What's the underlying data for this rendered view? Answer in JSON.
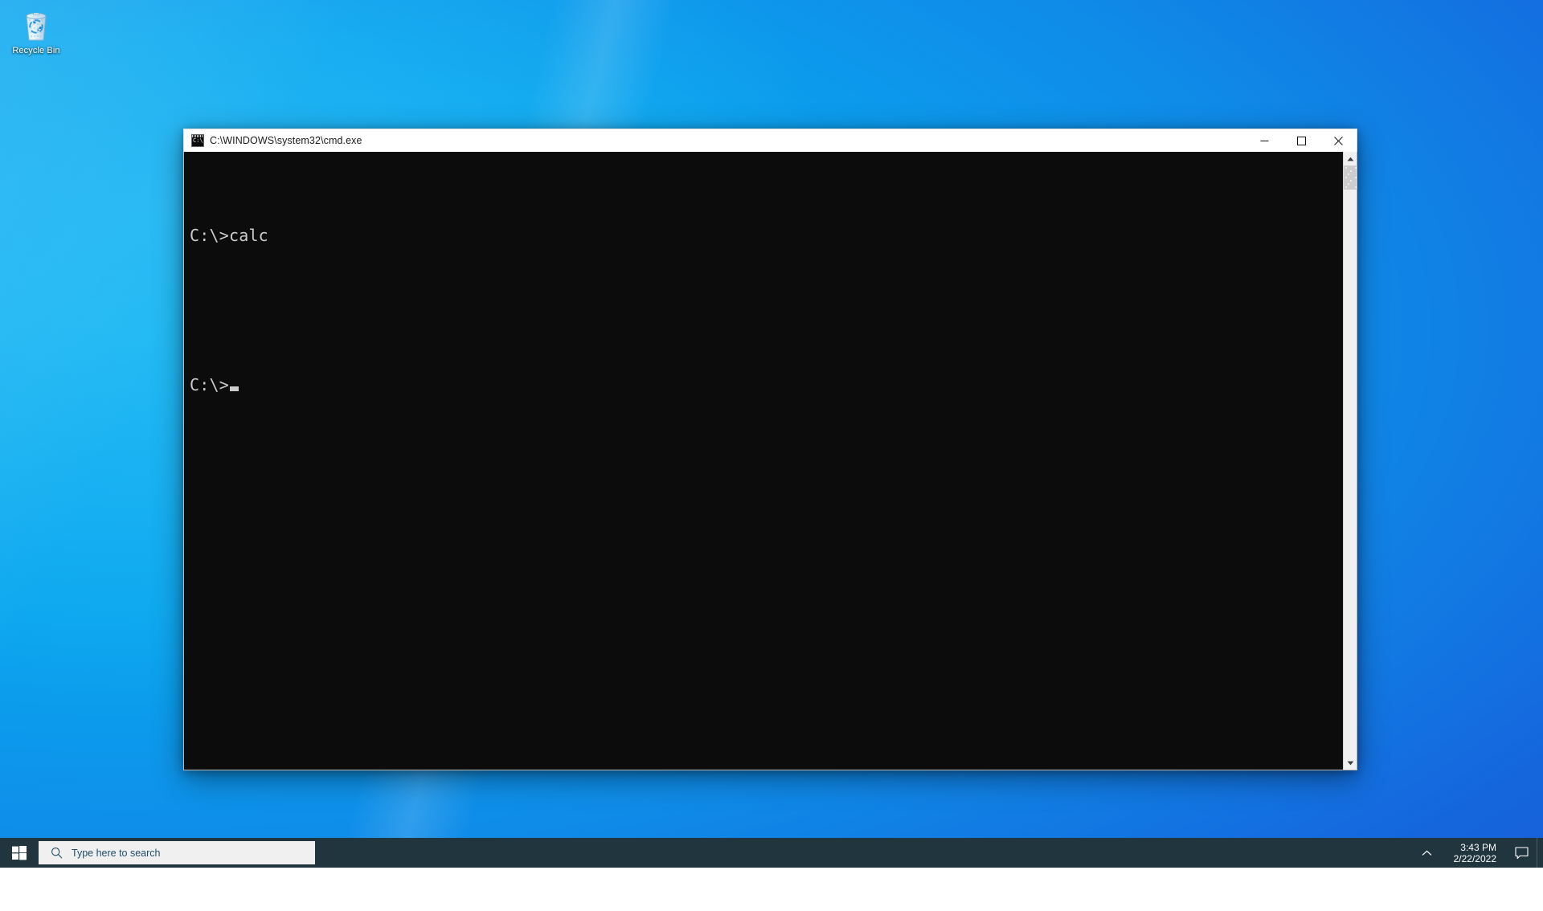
{
  "desktop": {
    "background_colors": {
      "light_blue": "#0aa6ef",
      "mid_blue": "#0f8ae8",
      "dark_blue": "#1a4fd0"
    },
    "icons": [
      {
        "name": "recycle-bin",
        "label": "Recycle Bin",
        "icon": "recycle-bin-icon"
      }
    ]
  },
  "cmd_window": {
    "title": "C:\\WINDOWS\\system32\\cmd.exe",
    "title_icon": "cmd-console-icon",
    "icon_text": "C:\\",
    "controls": {
      "minimize": "—",
      "maximize": "□",
      "close": "✕",
      "minimize_name": "minimize-button",
      "maximize_name": "maximize-button",
      "close_name": "close-button"
    },
    "console": {
      "background": "#0c0c0c",
      "foreground": "#cccccc",
      "lines": [
        "C:\\>calc",
        "",
        "C:\\>"
      ],
      "cursor": "block-cursor"
    },
    "scrollbar": {
      "up_arrow": "▲",
      "down_arrow": "▼",
      "thumb_position_percent": 0
    }
  },
  "taskbar": {
    "background": "#21353f",
    "start_button": "start-button",
    "search": {
      "placeholder": "Type here to search",
      "icon": "search-icon"
    },
    "tray": {
      "chevron": "∧",
      "chevron_icon": "chevron-up-icon",
      "time": "3:43 PM",
      "date": "2/22/2022",
      "action_center_icon": "notification-icon"
    }
  }
}
